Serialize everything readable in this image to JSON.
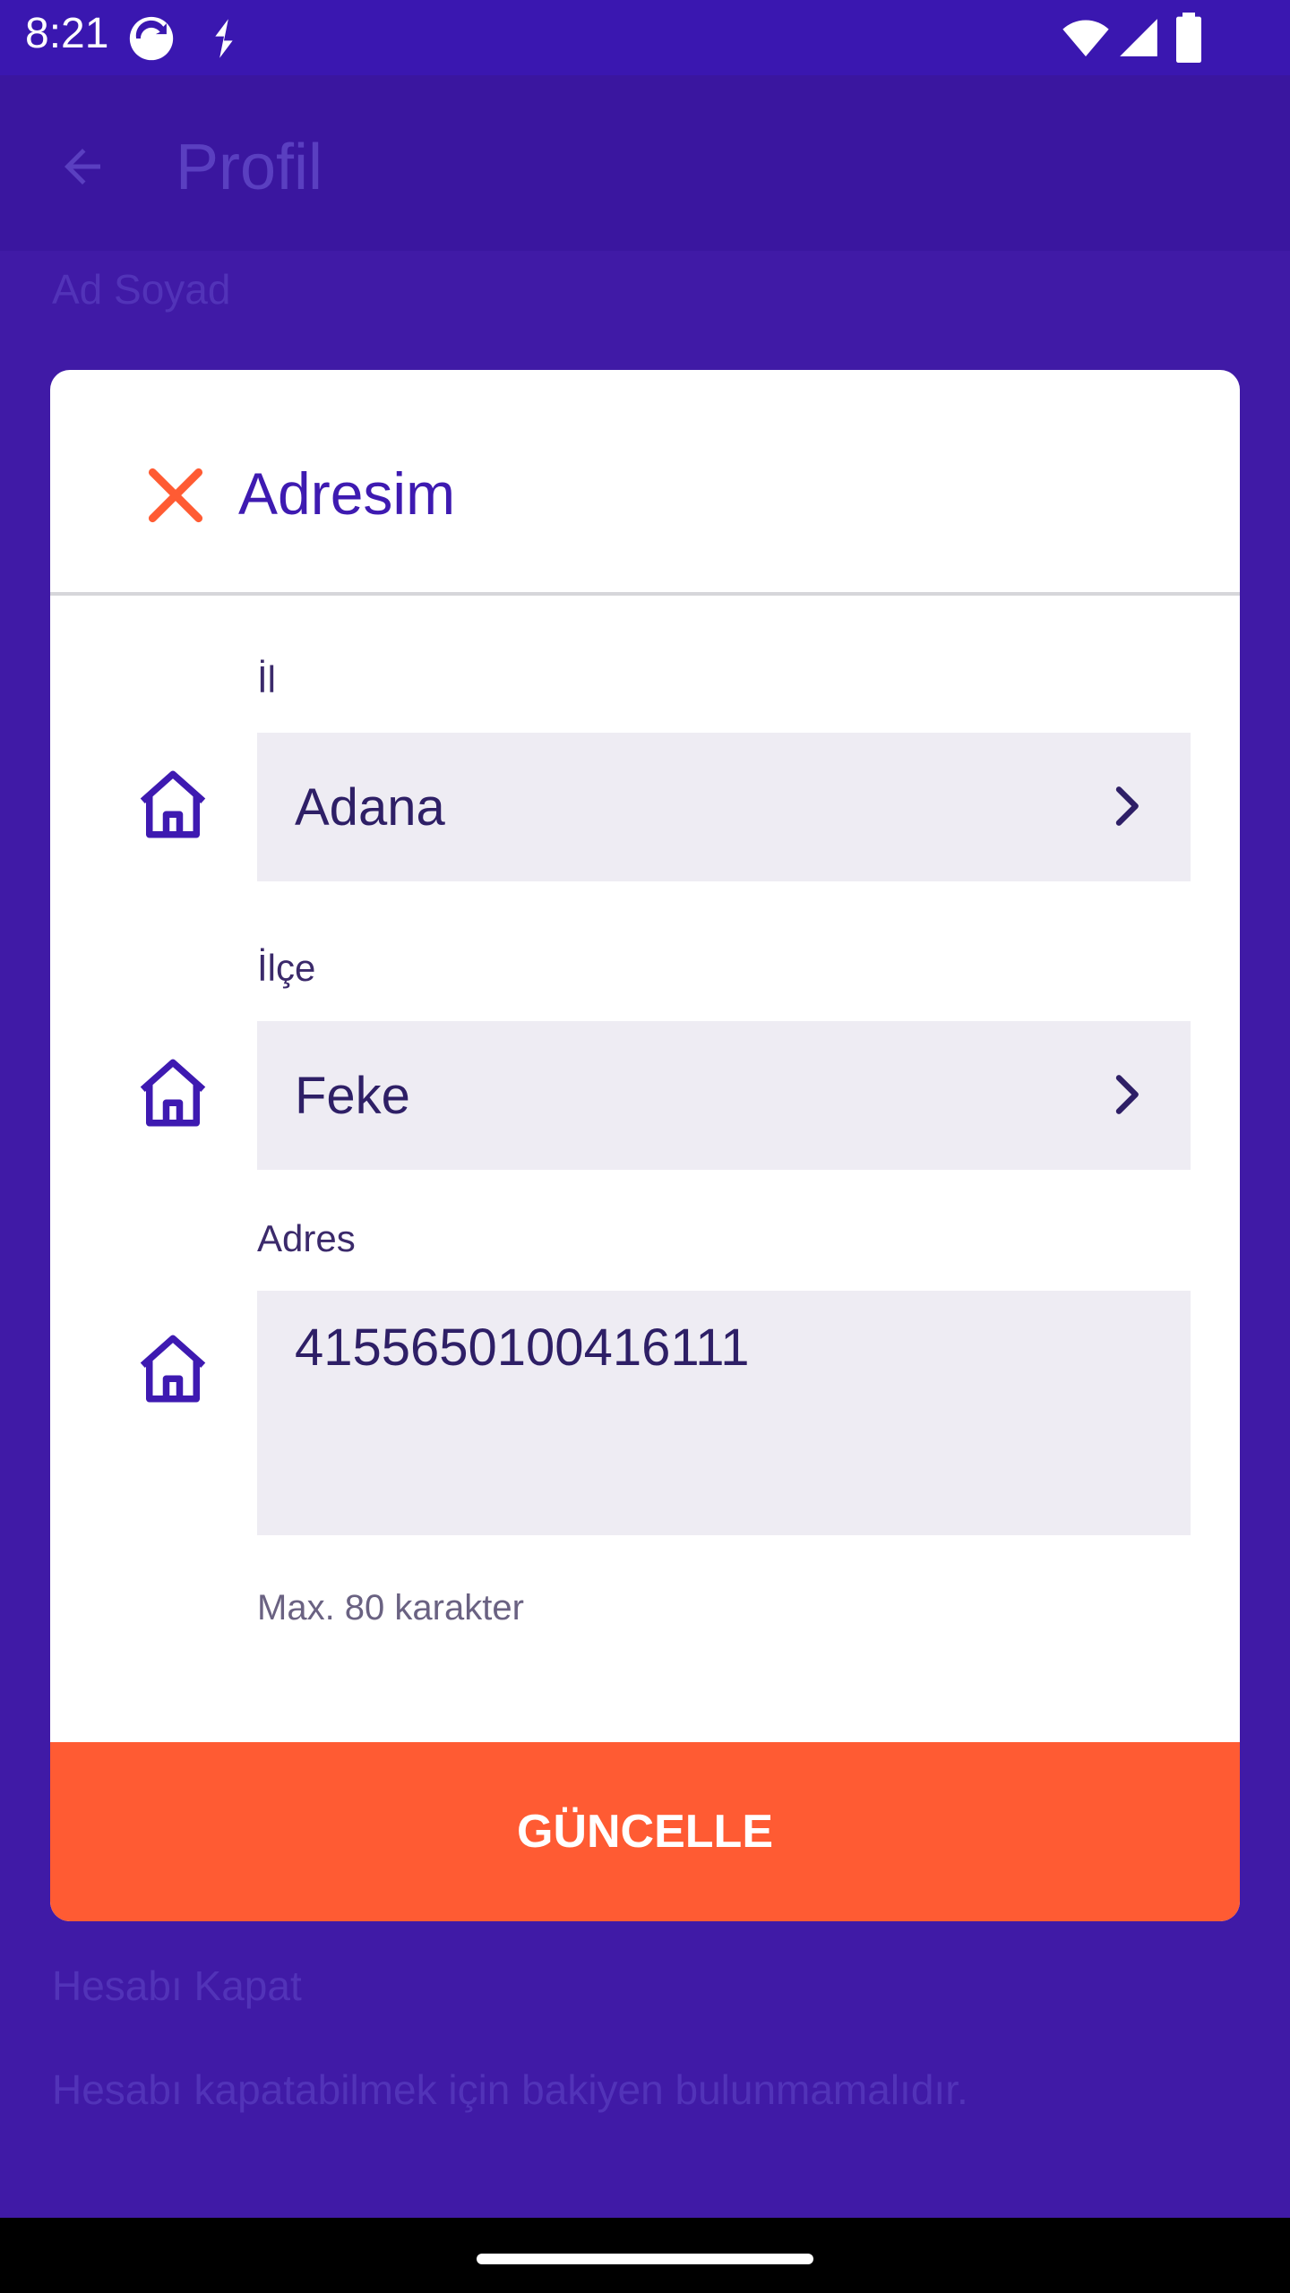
{
  "status_bar": {
    "time": "8:21"
  },
  "app_bar": {
    "title": "Profil"
  },
  "background": {
    "name_label": "Ad Soyad",
    "close_account_title": "Hesabı Kapat",
    "close_account_note": "Hesabı kapatabilmek için bakiyen bulunmamalıdır."
  },
  "dialog": {
    "title": "Adresim",
    "fields": {
      "province": {
        "label": "İl",
        "value": "Adana"
      },
      "district": {
        "label": "İlçe",
        "value": "Feke"
      },
      "address": {
        "label": "Adres",
        "value": "4155650100416111",
        "helper": "Max. 80 karakter"
      }
    },
    "submit_label": "GÜNCELLE"
  },
  "colors": {
    "accent": "#3e1ab1",
    "button": "#ff5b33",
    "close": "#ff5b33",
    "field_bg": "#eeecf3"
  },
  "icons": {
    "close": "close-icon",
    "field": "home-icon",
    "select": "chevron-right-icon"
  }
}
